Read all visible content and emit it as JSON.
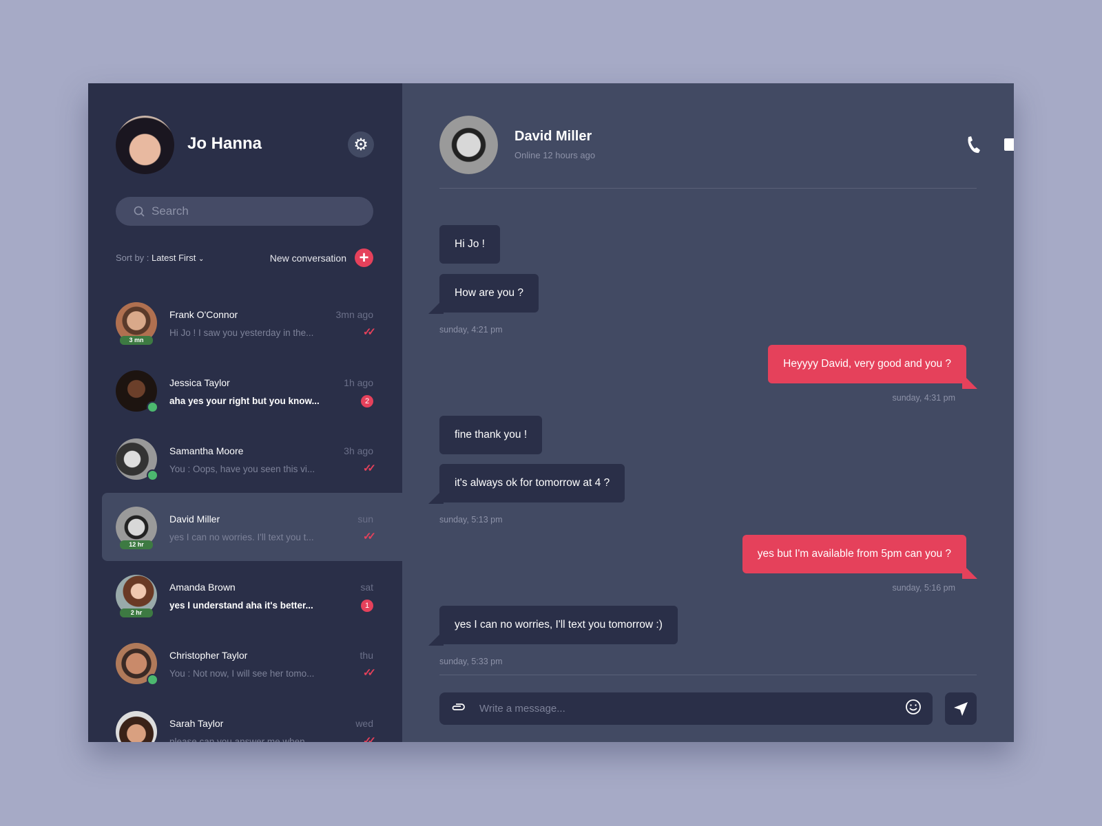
{
  "colors": {
    "accent": "#e5415b",
    "sidebar": "#2a2f48",
    "main": "#424a63",
    "online": "#4cb86f",
    "background": "#a6aac6"
  },
  "user": {
    "name": "Jo Hanna"
  },
  "search": {
    "placeholder": "Search"
  },
  "sort": {
    "label": "Sort by :",
    "value": "Latest First"
  },
  "new_conversation": "New conversation",
  "conversations": [
    {
      "name": "Frank O'Connor",
      "preview": "Hi Jo ! I saw you yesterday in the...",
      "time": "3mn ago",
      "tag": "3 mn",
      "status": "read",
      "unread": 0
    },
    {
      "name": "Jessica Taylor",
      "preview": "aha yes your right but you know...",
      "time": "1h ago",
      "online": true,
      "unread": 2,
      "unread_label": "2"
    },
    {
      "name": "Samantha Moore",
      "preview": "You : Oops, have you seen this vi...",
      "time": "3h ago",
      "online": true,
      "status": "read"
    },
    {
      "name": "David Miller",
      "preview": "yes I can no worries. I'll text you t...",
      "time": "sun",
      "tag": "12 hr",
      "status": "read",
      "selected": true
    },
    {
      "name": "Amanda Brown",
      "preview": "yes I understand aha it's better...",
      "time": "sat",
      "tag": "2 hr",
      "unread": 1,
      "unread_label": "1"
    },
    {
      "name": "Christopher Taylor",
      "preview": "You : Not now, I will see her tomo...",
      "time": "thu",
      "online": true,
      "status": "read"
    },
    {
      "name": "Sarah Taylor",
      "preview": "please can you answer me when...",
      "time": "wed",
      "online": true,
      "status": "read"
    }
  ],
  "chat": {
    "name": "David Miller",
    "status": "Online 12 hours ago",
    "messages": [
      {
        "text": "Hi Jo !",
        "dir": "in"
      },
      {
        "text": "How are you ?",
        "dir": "in"
      },
      {
        "timestamp": "sunday, 4:21 pm"
      },
      {
        "text": "Heyyyy David, very good and you ?",
        "dir": "out"
      },
      {
        "timestamp": "sunday, 4:31 pm"
      },
      {
        "text": "fine thank you !",
        "dir": "in"
      },
      {
        "text": "it's always ok for tomorrow at 4 ?",
        "dir": "in"
      },
      {
        "timestamp": "sunday, 5:13 pm"
      },
      {
        "text": "yes but I'm available from 5pm can you ?",
        "dir": "out"
      },
      {
        "timestamp": "sunday, 5:16 pm"
      },
      {
        "text": "yes I can no worries, I'll text you tomorrow :)",
        "dir": "in"
      },
      {
        "timestamp": "sunday, 5:33 pm"
      }
    ],
    "input_placeholder": "Write a message..."
  },
  "icons": {
    "settings": "gear-icon",
    "search": "search-icon",
    "add": "plus-icon",
    "call": "phone-icon",
    "video": "video-camera-icon",
    "info": "info-icon",
    "attach": "paperclip-icon",
    "emoji": "smiley-icon",
    "send": "send-icon",
    "read": "double-check-icon"
  }
}
